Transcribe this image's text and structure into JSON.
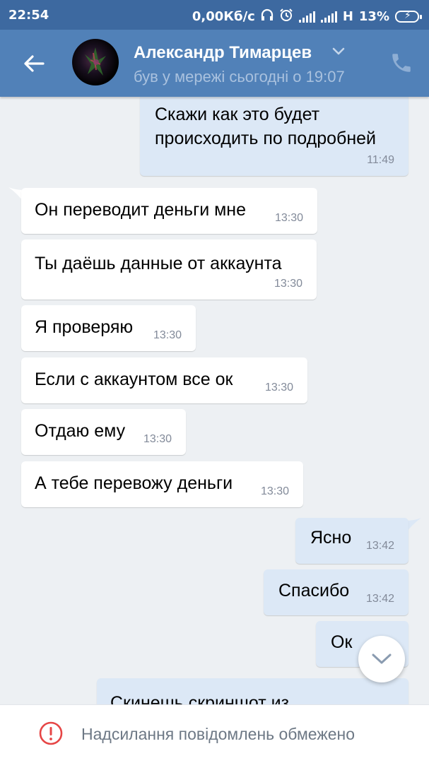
{
  "status_bar": {
    "time": "22:54",
    "speed": "0,00Кб/с",
    "network": "H",
    "battery": "13%"
  },
  "header": {
    "name": "Александр Тимарцев",
    "last_seen": "був у мережі сьогодні о 19:07",
    "accent": "#5181b8"
  },
  "messages": [
    {
      "dir": "out",
      "lines": [
        "Скажи как это будет",
        "происходить по подробней"
      ],
      "time": "11:49"
    },
    {
      "dir": "in",
      "text": "Он переводит деньги мне",
      "time": "13:30"
    },
    {
      "dir": "in",
      "text": "Ты даёшь данные от аккаунта",
      "time": "13:30"
    },
    {
      "dir": "in",
      "text": "Я проверяю",
      "time": "13:30"
    },
    {
      "dir": "in",
      "text": "Если с аккаунтом все ок",
      "time": "13:30"
    },
    {
      "dir": "in",
      "text": "Отдаю ему",
      "time": "13:30"
    },
    {
      "dir": "in",
      "text": "А тебе перевожу деньги",
      "time": "13:30"
    },
    {
      "dir": "out",
      "text": "Ясно",
      "time": "13:42"
    },
    {
      "dir": "out",
      "text": "Спасибо",
      "time": "13:42"
    },
    {
      "dir": "out",
      "text": "Ок",
      "time": ""
    },
    {
      "dir": "out",
      "text": "Скинешь скриншот из",
      "time": ""
    }
  ],
  "footer": {
    "notice": "Надсилання повідомлень обмежено"
  },
  "icons": {
    "back": "arrow-left-icon",
    "call": "phone-icon",
    "chevron": "chevron-down-icon",
    "scroll": "chevron-down-icon",
    "warning": "exclamation-circle-icon"
  }
}
